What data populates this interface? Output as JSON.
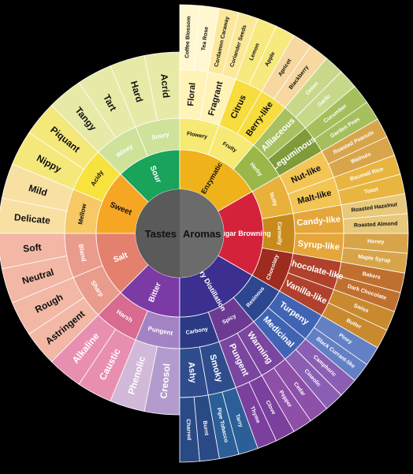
{
  "center": {
    "left": "Tastes",
    "right": "Aromas"
  },
  "tastes": {
    "tier1": [
      {
        "label": "Sour",
        "color": "#1aa35a"
      },
      {
        "label": "Sweet",
        "color": "#f6a623"
      },
      {
        "label": "Salt",
        "color": "#e4806e"
      },
      {
        "label": "Bitter",
        "color": "#7c3aa5"
      }
    ],
    "tier2": [
      {
        "label": "Soury",
        "color": "#cfe29a"
      },
      {
        "label": "Winey",
        "color": "#cfe29a"
      },
      {
        "label": "Acidy",
        "color": "#f8e23d"
      },
      {
        "label": "Mellow",
        "color": "#f6c965"
      },
      {
        "label": "Bland",
        "color": "#ea9c8c"
      },
      {
        "label": "Sharp",
        "color": "#ea9c8c"
      },
      {
        "label": "Harsh",
        "color": "#d86b8f"
      },
      {
        "label": "Pungent",
        "color": "#a383c3"
      }
    ],
    "tier3": [
      {
        "label": "Acrid",
        "color": "#e7eaa6"
      },
      {
        "label": "Hard",
        "color": "#e7eaa6"
      },
      {
        "label": "Tart",
        "color": "#e7eaa6"
      },
      {
        "label": "Tangy",
        "color": "#e7eaa6"
      },
      {
        "label": "Piquant",
        "color": "#f5e87a"
      },
      {
        "label": "Nippy",
        "color": "#f5e87a"
      },
      {
        "label": "Mild",
        "color": "#f7e0a2"
      },
      {
        "label": "Delicate",
        "color": "#f7e0a2"
      },
      {
        "label": "Soft",
        "color": "#f2b7a5"
      },
      {
        "label": "Neutral",
        "color": "#f2b7a5"
      },
      {
        "label": "Rough",
        "color": "#f2b7a5"
      },
      {
        "label": "Astringent",
        "color": "#f2b7a5"
      },
      {
        "label": "Alkaline",
        "color": "#e88fb1"
      },
      {
        "label": "Caustic",
        "color": "#e88fb1"
      },
      {
        "label": "Phenolic",
        "color": "#d2b8d9"
      },
      {
        "label": "Creosol",
        "color": "#b39ccd"
      }
    ]
  },
  "aromas": {
    "tier1": [
      {
        "label": "Enzymatic",
        "color": "#f0b21a"
      },
      {
        "label": "Sugar Browning",
        "color": "#d5223b"
      },
      {
        "label": "Dry Distillation",
        "color": "#3b2f8f"
      }
    ],
    "tier2": [
      {
        "label": "Flowery",
        "color": "#f6ea74"
      },
      {
        "label": "Fruity",
        "color": "#f6ea74"
      },
      {
        "label": "Herby",
        "color": "#9ab84a"
      },
      {
        "label": "Nutty",
        "color": "#e8b13c"
      },
      {
        "label": "Carmelly",
        "color": "#c88a1a"
      },
      {
        "label": "Chocolaty",
        "color": "#9d2b1e"
      },
      {
        "label": "Resinous",
        "color": "#2c4690"
      },
      {
        "label": "Spicy",
        "color": "#6c3a93"
      },
      {
        "label": "Carbony",
        "color": "#2c3a86"
      }
    ],
    "tier3": [
      {
        "label": "Floral",
        "color": "#fff3b8"
      },
      {
        "label": "Fragrant",
        "color": "#fff3b8"
      },
      {
        "label": "Citrus",
        "color": "#f7dd3d"
      },
      {
        "label": "Berry-like",
        "color": "#f7dd3d"
      },
      {
        "label": "Alliaceous",
        "color": "#a8c060"
      },
      {
        "label": "Leguminous",
        "color": "#7f9b3a"
      },
      {
        "label": "Nut-like",
        "color": "#f2c554"
      },
      {
        "label": "Malt-like",
        "color": "#f2c554"
      },
      {
        "label": "Candy-like",
        "color": "#e5a63a"
      },
      {
        "label": "Syrup-like",
        "color": "#e5a63a"
      },
      {
        "label": "Chocolate-like",
        "color": "#b0412d"
      },
      {
        "label": "Vanilla-like",
        "color": "#b0412d"
      },
      {
        "label": "Turpeny",
        "color": "#4064b3"
      },
      {
        "label": "Medicinal",
        "color": "#4064b3"
      },
      {
        "label": "Warming",
        "color": "#7b469f"
      },
      {
        "label": "Pungent",
        "color": "#7b469f"
      },
      {
        "label": "Smoky",
        "color": "#2f4c8c"
      },
      {
        "label": "Ashy",
        "color": "#2f4c8c"
      }
    ],
    "tier4": [
      {
        "label": "Coffee Blossom",
        "color": "#fff7d0"
      },
      {
        "label": "Tea Rose",
        "color": "#fff7d0"
      },
      {
        "label": "Cardamon Caraway",
        "color": "#fbe89a"
      },
      {
        "label": "Coriander Seeds",
        "color": "#fbe89a"
      },
      {
        "label": "Lemon",
        "color": "#f8e97f"
      },
      {
        "label": "Apple",
        "color": "#f8e97f"
      },
      {
        "label": "Apricot",
        "color": "#f6d8a0"
      },
      {
        "label": "Blackberry",
        "color": "#f6d8a0"
      },
      {
        "label": "Onion",
        "color": "#c8d88a"
      },
      {
        "label": "Garlic",
        "color": "#c8d88a"
      },
      {
        "label": "Cucumber",
        "color": "#a5bf5d"
      },
      {
        "label": "Garden Peas",
        "color": "#a5bf5d"
      },
      {
        "label": "Roasted Peanuts",
        "color": "#d9a54a"
      },
      {
        "label": "Walnuts",
        "color": "#d9a54a"
      },
      {
        "label": "Basmati Rice",
        "color": "#e8b540"
      },
      {
        "label": "Toast",
        "color": "#e8b540"
      },
      {
        "label": "Roasted Hazelnut",
        "color": "#e8c87a"
      },
      {
        "label": "Roasted Almond",
        "color": "#e8c87a"
      },
      {
        "label": "Honey",
        "color": "#d8a44a"
      },
      {
        "label": "Maple Syrup",
        "color": "#d8a44a"
      },
      {
        "label": "Bakers",
        "color": "#c0702e"
      },
      {
        "label": "Dark Chocolate",
        "color": "#c0702e"
      },
      {
        "label": "Swiss",
        "color": "#c98a2f"
      },
      {
        "label": "Butter",
        "color": "#c98a2f"
      },
      {
        "label": "Piney",
        "color": "#6480c4"
      },
      {
        "label": "Black Currant-like",
        "color": "#6480c4"
      },
      {
        "label": "Camphoric",
        "color": "#8a5fb3"
      },
      {
        "label": "Cineolic",
        "color": "#8a5fb3"
      },
      {
        "label": "Cedar",
        "color": "#8e4fa8"
      },
      {
        "label": "Pepper",
        "color": "#8e4fa8"
      },
      {
        "label": "Clove",
        "color": "#7b3f9e"
      },
      {
        "label": "Thyme",
        "color": "#7b3f9e"
      },
      {
        "label": "Tarry",
        "color": "#2c5f98"
      },
      {
        "label": "Pipe Tobacco",
        "color": "#2c5f98"
      },
      {
        "label": "Burnt",
        "color": "#2a4a86"
      },
      {
        "label": "Charred",
        "color": "#2a4a86"
      }
    ]
  }
}
